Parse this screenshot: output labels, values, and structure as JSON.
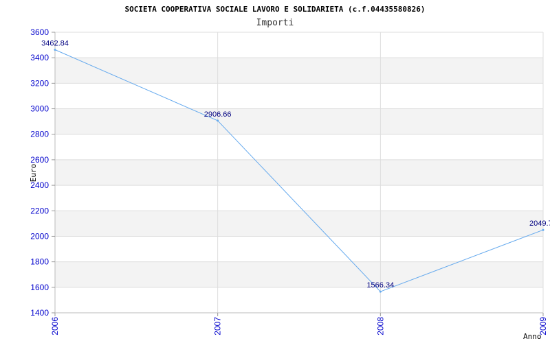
{
  "chart_data": {
    "type": "line",
    "title": "SOCIETA COOPERATIVA SOCIALE LAVORO E SOLIDARIETA (c.f.04435580826)",
    "subtitle": "Importi",
    "xlabel": "Anno",
    "ylabel": "Euro",
    "x": [
      "2006",
      "2007",
      "2008",
      "2009"
    ],
    "series": [
      {
        "values": [
          3462.84,
          2906.66,
          1566.34,
          2049.7
        ]
      }
    ],
    "data_labels": [
      "3462.84",
      "2906.66",
      "1566.34",
      "2049.7"
    ],
    "ylim": [
      1400,
      3600
    ],
    "yticks": [
      1400,
      1600,
      1800,
      2000,
      2200,
      2400,
      2600,
      2800,
      3000,
      3200,
      3400,
      3600
    ],
    "grid": true,
    "line_color": "#66aaee",
    "band_color": "#f3f3f3",
    "grid_color": "#dddddd",
    "tick_color": "#0000cc",
    "label_color": "#000080"
  }
}
